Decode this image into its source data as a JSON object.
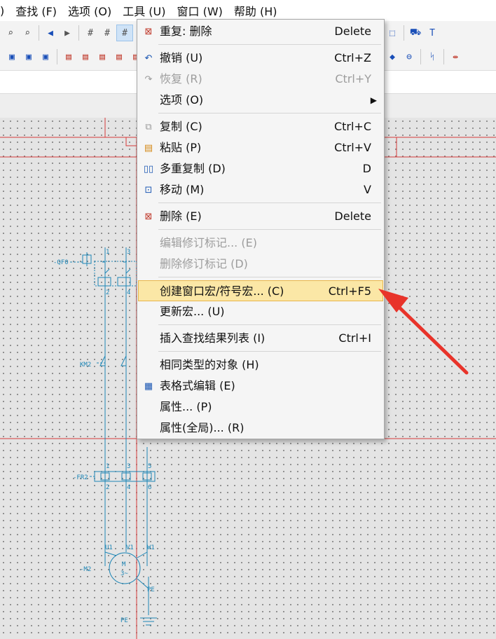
{
  "menubar": {
    "items": [
      {
        "label": ")"
      },
      {
        "label": "查找 (F)"
      },
      {
        "label": "选项 (O)"
      },
      {
        "label": "工具 (U)"
      },
      {
        "label": "窗口 (W)"
      },
      {
        "label": "帮助 (H)"
      }
    ]
  },
  "toolbar": {
    "row1_icons": [
      "zoom-out-icon",
      "zoom-100-icon",
      "back-arrow-icon",
      "forward-arrow-icon",
      "grid-a-icon",
      "grid-icon",
      "grid-selected-icon",
      "grid-partial-icon",
      "select-frame-icon",
      "cart-icon",
      "text-box-icon"
    ],
    "row2_icons": [
      "symbol-a-icon",
      "symbol-b-icon",
      "symbol-c-icon",
      "wire-a-icon",
      "wire-b-icon",
      "wire-c-icon",
      "wire-d-icon",
      "wire-e-icon",
      "diamond-node-icon",
      "terminal-icon",
      "branch-icon"
    ]
  },
  "context_menu": {
    "items": [
      {
        "label": "重复: 删除",
        "shortcut": "Delete",
        "icon": "delete-icon",
        "enabled": true
      },
      {
        "label": "撤销 (U)",
        "shortcut": "Ctrl+Z",
        "icon": "undo-icon",
        "enabled": true
      },
      {
        "label": "恢复 (R)",
        "shortcut": "Ctrl+Y",
        "icon": "redo-icon",
        "enabled": false
      },
      {
        "label": "选项 (O)",
        "shortcut": "",
        "icon": "",
        "enabled": true,
        "submenu": true
      },
      {
        "label": "复制 (C)",
        "shortcut": "Ctrl+C",
        "icon": "copy-icon",
        "enabled": true
      },
      {
        "label": "粘贴 (P)",
        "shortcut": "Ctrl+V",
        "icon": "paste-icon",
        "enabled": true
      },
      {
        "label": "多重复制 (D)",
        "shortcut": "D",
        "icon": "multi-copy-icon",
        "enabled": true
      },
      {
        "label": "移动 (M)",
        "shortcut": "V",
        "icon": "move-icon",
        "enabled": true
      },
      {
        "label": "删除 (E)",
        "shortcut": "Delete",
        "icon": "delete-icon",
        "enabled": true
      },
      {
        "label": "编辑修订标记... (E)",
        "shortcut": "",
        "icon": "",
        "enabled": false
      },
      {
        "label": "删除修订标记 (D)",
        "shortcut": "",
        "icon": "",
        "enabled": false
      },
      {
        "label": "创建窗口宏/符号宏... (C)",
        "shortcut": "Ctrl+F5",
        "icon": "",
        "enabled": true,
        "highlighted": true
      },
      {
        "label": "更新宏... (U)",
        "shortcut": "",
        "icon": "",
        "enabled": true
      },
      {
        "label": "插入查找结果列表 (I)",
        "shortcut": "Ctrl+I",
        "icon": "",
        "enabled": true
      },
      {
        "label": "相同类型的对象 (H)",
        "shortcut": "",
        "icon": "",
        "enabled": true
      },
      {
        "label": "表格式编辑 (E)",
        "shortcut": "",
        "icon": "table-icon",
        "enabled": true
      },
      {
        "label": "属性... (P)",
        "shortcut": "",
        "icon": "",
        "enabled": true
      },
      {
        "label": "属性(全局)... (R)",
        "shortcut": "",
        "icon": "",
        "enabled": true
      }
    ]
  },
  "schematic": {
    "labels": {
      "qf": "-QF0",
      "km": "KM2",
      "fr": "-FR2",
      "motor": "-M2",
      "motor_symbol": "M",
      "motor_phase": "3~",
      "pe": "PE",
      "u1": "U1",
      "v1": "V1",
      "w1": "W1",
      "pe_small": "PE",
      "n1": "1",
      "n2": "2",
      "n3": "3",
      "n4": "4",
      "n5": "5",
      "n6": "6"
    }
  },
  "colors": {
    "schematic_line": "#1e86b6",
    "border_line": "#d63a3a",
    "menu_highlight": "#fbe7a6",
    "annotation_arrow": "#e8332a"
  }
}
